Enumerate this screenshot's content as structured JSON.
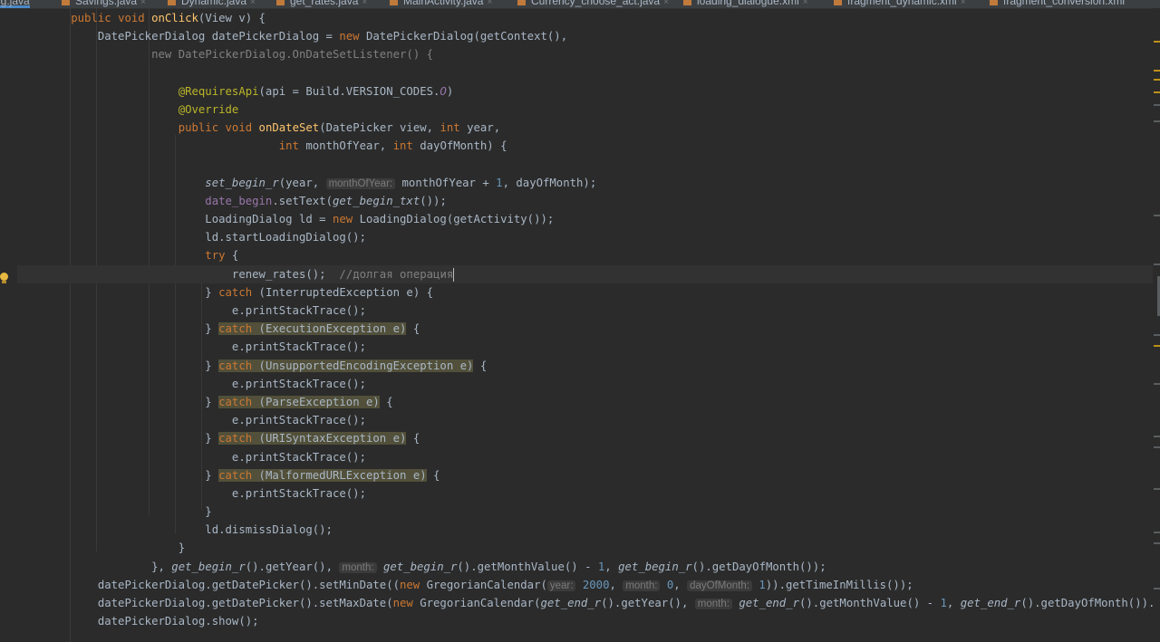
{
  "tabs": [
    {
      "label": "ng.java",
      "active": true
    },
    {
      "label": "Savings.java",
      "active": false
    },
    {
      "label": "Dynamic.java",
      "active": false
    },
    {
      "label": "get_rates.java",
      "active": false
    },
    {
      "label": "MainActivity.java",
      "active": false
    },
    {
      "label": "Currency_choose_act.java",
      "active": false
    },
    {
      "label": "loading_dialogue.xml",
      "active": false
    },
    {
      "label": "fragment_dynamic.xml",
      "active": false
    },
    {
      "label": "fragment_conversion.xml",
      "active": false
    }
  ],
  "tab_close_glyph": "×",
  "code": {
    "kw_public": "public",
    "kw_void": "void",
    "kw_new": "new",
    "kw_int": "int",
    "kw_try": "try",
    "kw_catch": "catch",
    "l1": {
      "method": "onClick",
      "args": "(View v) {"
    },
    "l2": {
      "a": "DatePickerDialog datePickerDialog = ",
      "b": "DatePickerDialog(getContext(),"
    },
    "l3": {
      "b": "DatePickerDialog.OnDateSetListener() {"
    },
    "l5": {
      "ann": "@RequiresApi",
      "a": "(api = Build.VERSION_CODES.",
      "b": "O",
      ")": ")"
    },
    "l6": {
      "ann": "@Override"
    },
    "l7": {
      "method": "onDateSet",
      "a": "(DatePicker view, ",
      "b": " year,"
    },
    "l8": {
      "a": " monthOfYear, ",
      "b": " dayOfMonth) {"
    },
    "l10": {
      "method": "set_begin_r",
      "a": "(year, ",
      "hint": "monthOfYear:",
      "b": " monthOfYear + ",
      "n1": "1",
      ", dayOfMonth);": ", dayOfMonth);"
    },
    "l11": {
      "field": "date_begin",
      "a": ".setText(",
      "m": "get_begin_txt",
      "b": "());"
    },
    "l12": {
      "a": "LoadingDialog ld = ",
      "b": "LoadingDialog(getActivity());"
    },
    "l13": {
      "a": "ld.startLoadingDialog();"
    },
    "l14": {
      "b": " {"
    },
    "l15": {
      "a": "renew_rates();  ",
      "c": "//долгая операция"
    },
    "catches": [
      {
        "exc": " (InterruptedException e)",
        "hl": false
      },
      {
        "exc": " (ExecutionException e)",
        "hl": true
      },
      {
        "exc": " (UnsupportedEncodingException e)",
        "hl": true
      },
      {
        "exc": " (ParseException e)",
        "hl": true
      },
      {
        "exc": " (URISyntaxException e)",
        "hl": true
      },
      {
        "exc": " (MalformedURLException e)",
        "hl": true
      }
    ],
    "close_brace": "} ",
    "open_brace": " {",
    "closing": "}",
    "print": "e.printStackTrace();",
    "l29": {
      "a": "ld.dismissDialog();"
    },
    "l30": {
      "a": "}"
    },
    "l31": {
      "a": "}, ",
      "m1": "get_begin_r",
      "b": "().getYear(), ",
      "hint": "month:",
      "m2": "get_begin_r",
      "c": "().getMonthValue() - ",
      "n": "1",
      ",": ", ",
      "m3": "get_begin_r",
      "d": "().getDayOfMonth());"
    },
    "l32": {
      "a": "datePickerDialog.getDatePicker().setMinDate((",
      "b": "GregorianCalendar(",
      "h1": "year:",
      "n1": "2000",
      ",1": ", ",
      "h2": "month:",
      "n2": "0",
      ",2": ", ",
      "h3": "dayOfMonth:",
      "n3": "1",
      "e": ")).getTimeInMillis());"
    },
    "l33": {
      "a": "datePickerDialog.getDatePicker().setMaxDate(",
      "b": "GregorianCalendar(",
      "m1": "get_end_r",
      "c": "().getYear(), ",
      "hint": "month:",
      "m2": "get_end_r",
      "d": "().getMonthValue() - ",
      "n": "1",
      ",": ", ",
      "m3": "get_end_r",
      "e": "().getDayOfMonth()).getTi"
    },
    "l34": {
      "a": "datePickerDialog.show();"
    }
  },
  "colors": {
    "background": "#2b2b2b",
    "keyword": "#cc7832",
    "method": "#ffc66d",
    "annotation": "#bbb529",
    "number": "#6897bb",
    "comment": "#808080",
    "field": "#9876aa",
    "text": "#a9b7c6",
    "highlight": "#52503a"
  }
}
